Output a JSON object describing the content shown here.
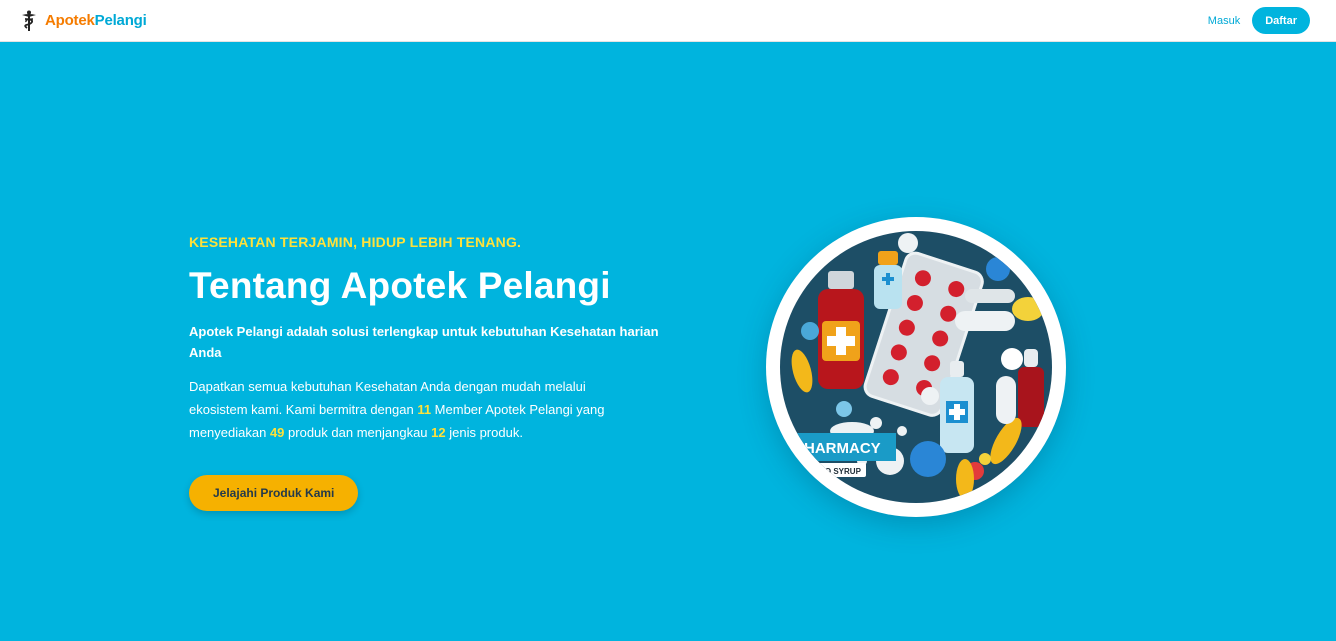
{
  "navbar": {
    "brand_part1": "Apotek",
    "brand_part2": "Pelangi",
    "login_label": "Masuk",
    "register_label": "Daftar",
    "logo_icon": "caduceus-icon"
  },
  "hero": {
    "eyebrow": "KESEHATAN TERJAMIN, HIDUP LEBIH TENANG.",
    "title": "Tentang Apotek Pelangi",
    "lead": "Apotek Pelangi adalah solusi terlengkap untuk kebutuhan Kesehatan harian Anda",
    "desc_part1": "Dapatkan semua kebutuhan Kesehatan Anda dengan mudah melalui ekosistem kami. Kami bermitra dengan ",
    "members_count": "11",
    "desc_part2": " Member Apotek Pelangi yang menyediakan ",
    "products_count": "49",
    "desc_part3": " produk dan menjangkau ",
    "categories_count": "12",
    "desc_part4": " jenis produk.",
    "cta_label": "Jelajahi Produk Kami"
  },
  "illustration": {
    "label_main": "PHARMACY",
    "label_sub": "HERO SYRUP"
  },
  "colors": {
    "hero_bg": "#00b4de",
    "accent_yellow": "#ffe13a",
    "cta_bg": "#f6b100",
    "brand_orange": "#f57c00",
    "brand_blue": "#00a9d6"
  }
}
